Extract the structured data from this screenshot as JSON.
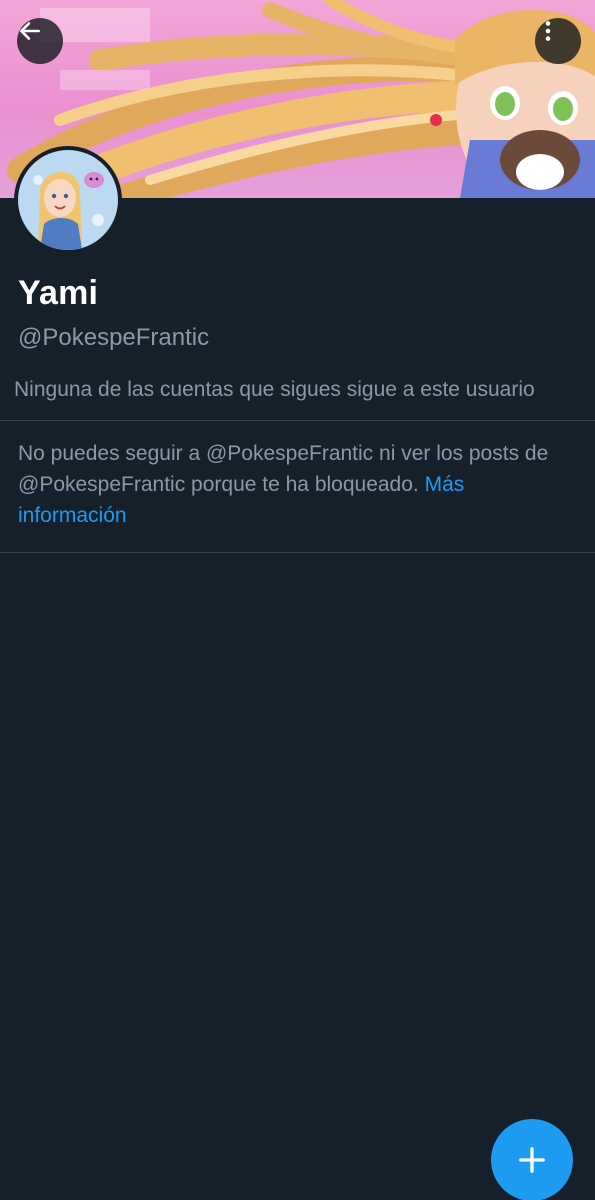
{
  "profile": {
    "display_name": "Yami",
    "handle": "@PokespeFrantic",
    "followers_note": "Ninguna de las cuentas que sigues sigue a este usuario"
  },
  "blocked_notice": {
    "text": "No puedes seguir a @PokespeFrantic ni ver los posts de @PokespeFrantic porque te ha bloqueado. ",
    "link_text": "Más información"
  },
  "icons": {
    "back": "arrow-left-icon",
    "more": "vertical-dots-icon",
    "compose": "plus-icon"
  },
  "colors": {
    "background": "#15202b",
    "accent": "#1d9bf0",
    "secondary_text": "#8b98a5",
    "divider": "#38444d"
  }
}
